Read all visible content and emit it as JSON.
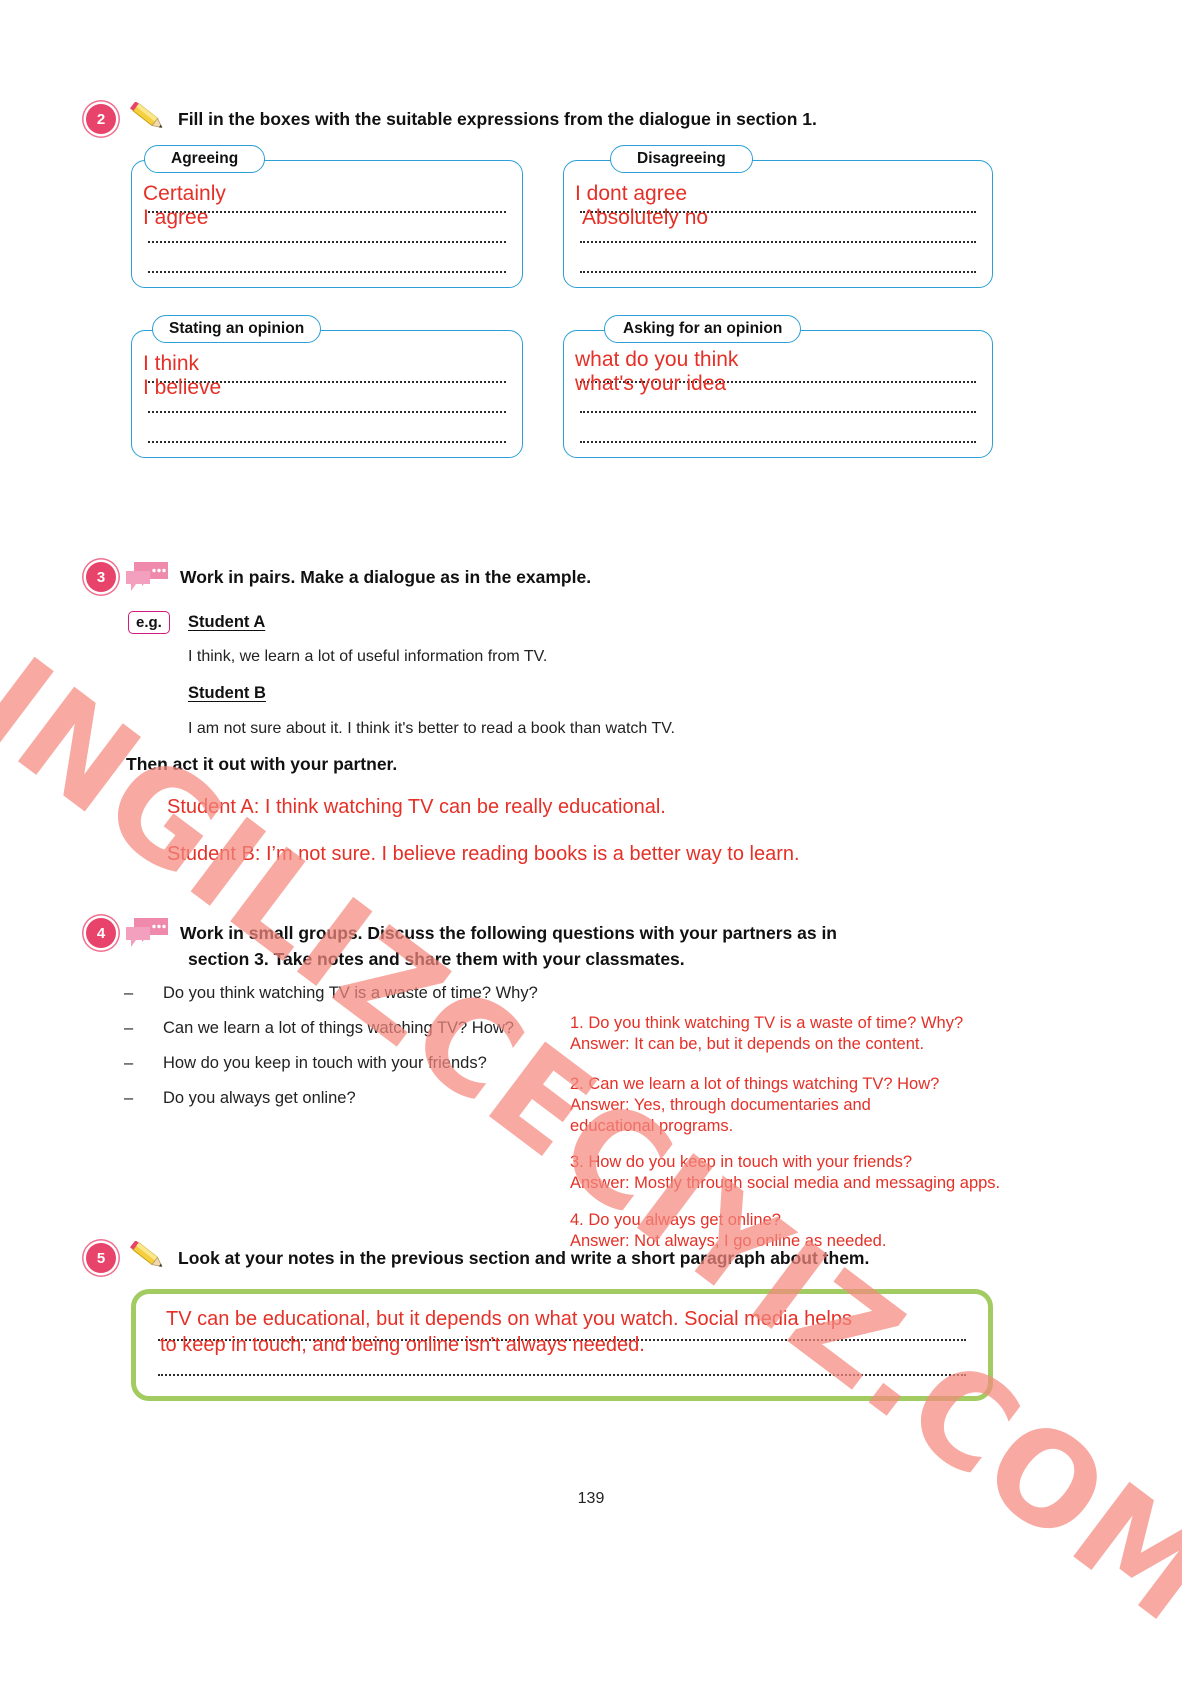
{
  "page": {
    "number": "139"
  },
  "section2": {
    "number": "2",
    "icon": "pencil-icon",
    "instruction": "Fill in the boxes with the suitable expressions from the dialogue in section 1.",
    "boxes": [
      {
        "label": "Agreeing",
        "answers": [
          "Certainly",
          "I agree"
        ]
      },
      {
        "label": "Disagreeing",
        "answers": [
          "I dont agree",
          "Absolutely no"
        ]
      },
      {
        "label": "Stating an opinion",
        "answers": [
          "I think",
          "I believe"
        ]
      },
      {
        "label": "Asking for an opinion",
        "answers": [
          "what do you think",
          "what's your idea"
        ]
      }
    ]
  },
  "section3": {
    "number": "3",
    "icon": "speech-bubbles-icon",
    "instruction": "Work in pairs. Make a dialogue as in the example.",
    "eg_label": "e.g.",
    "student_a_label": "Student A",
    "student_a_line": "I think, we learn a lot of useful information from TV.",
    "student_b_label": "Student B",
    "student_b_line": "I am not sure about it. I think it's better to read a book than watch TV.",
    "then_line": "Then act it out with your partner.",
    "answers": [
      "Student A: I think watching TV can be really educational.",
      "Student B: I’m not sure. I believe reading books is a better way to learn."
    ]
  },
  "section4": {
    "number": "4",
    "icon": "speech-bubbles-icon",
    "instruction_line1": "Work in small groups. Discuss the following questions with your partners as in",
    "instruction_line2": "section 3. Take notes and share them with your classmates.",
    "questions": [
      "Do you think watching TV is a waste of time? Why?",
      "Can we learn a lot of things watching TV? How?",
      "How do you keep in touch with your friends?",
      "Do you always get online?"
    ],
    "notes": [
      "1. Do you think watching TV is a waste of time? Why?",
      "Answer: It can be, but it depends on the content.",
      "",
      "2. Can we learn a lot of things watching TV? How?",
      "Answer: Yes, through documentaries and",
      "educational programs.",
      "",
      "3. How do you keep in touch with your friends?",
      "Answer: Mostly through social media and messaging apps.",
      "",
      "4. Do you always get online?",
      "Answer: Not always; I go online as needed."
    ]
  },
  "section5": {
    "number": "5",
    "icon": "pencil-icon",
    "instruction": "Look at your notes in the previous section and write a short paragraph about them.",
    "answer_lines": [
      "TV can be educational, but it depends on what you watch. Social media helps",
      "to keep in touch, and being online isn’t always needed."
    ]
  },
  "watermark": {
    "text": "INGILIZCECIYIZ.COM",
    "color": "#f4897f"
  },
  "colors": {
    "badge": "#e8446b",
    "box_border": "#2e9fd4",
    "ink": "#e53027",
    "green_border": "#a2cc62",
    "bubble": "#f08aad"
  }
}
